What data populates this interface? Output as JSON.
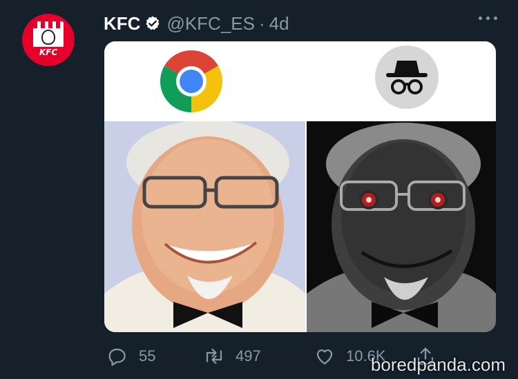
{
  "tweet": {
    "author_name": "KFC",
    "handle": "@KFC_ES",
    "separator": "·",
    "time": "4d",
    "avatar_text": "KFC"
  },
  "media": {
    "left_icon": "chrome-logo-icon",
    "right_icon": "incognito-icon"
  },
  "actions": {
    "replies": "55",
    "retweets": "497",
    "likes": "10.6K"
  },
  "icons": [
    "verified-badge-icon",
    "more-icon",
    "reply-icon",
    "retweet-icon",
    "like-icon",
    "share-icon"
  ],
  "watermark": "boredpanda.com",
  "colors": {
    "background": "#15202b",
    "secondary_text": "#8899a6",
    "kfc_red": "#e4002b"
  }
}
